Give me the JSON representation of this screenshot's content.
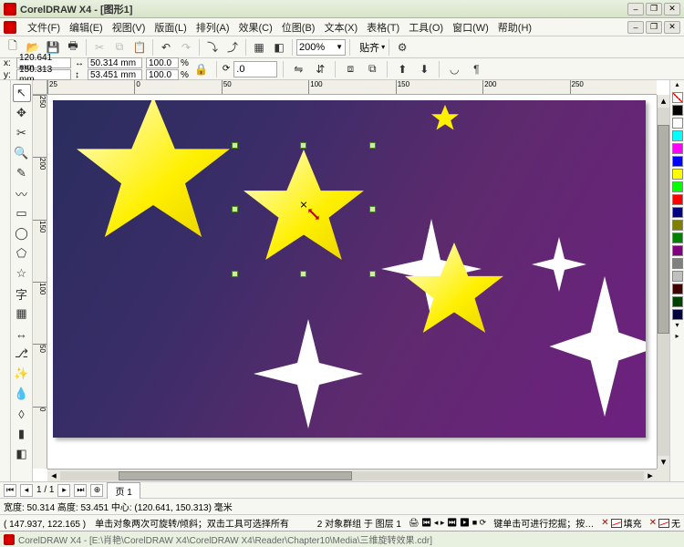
{
  "title": "CorelDRAW X4 - [图形1]",
  "menu": [
    "文件(F)",
    "编辑(E)",
    "视图(V)",
    "版面(L)",
    "排列(A)",
    "效果(C)",
    "位图(B)",
    "文本(X)",
    "表格(T)",
    "工具(O)",
    "窗口(W)",
    "帮助(H)"
  ],
  "toolbar_std": {
    "zoom": "200%",
    "snap_label": "贴齐"
  },
  "props": {
    "x": "120.641 mm",
    "y": "150.313 mm",
    "w": "50.314 mm",
    "h": "53.451 mm",
    "sx": "100.0",
    "sy": "100.0",
    "rot": ".0"
  },
  "ruler_h": [
    "25",
    "0",
    "50",
    "100",
    "150",
    "200",
    "250"
  ],
  "ruler_v": [
    "250",
    "200",
    "150",
    "100",
    "50",
    "0"
  ],
  "pager": {
    "page_of": "1 / 1",
    "tab": "页 1"
  },
  "status": {
    "dims": "宽度: 50.314 高度: 53.451 中心: (120.641, 150.313) 毫米",
    "helper_pre": "( 147.937, 122.165 )　单击对象两次可旋转/倾斜；双击工具可选择所有",
    "selection": "2 对象群组 于 图层 1",
    "helper_post": "键单击可进行挖掘；按…",
    "fill_label": "填充",
    "outline_label": "无"
  },
  "taskbar": "CorelDRAW X4 - [E:\\肖艳\\CorelDRAW X4\\CorelDRAW X4\\Reader\\Chapter10\\Media\\三维旋转效果.cdr]",
  "tools": [
    "pick",
    "shape",
    "crop",
    "zoom",
    "freehand",
    "smart",
    "rect",
    "ellipse",
    "polygon",
    "shapes",
    "text",
    "table",
    "dimension",
    "connector",
    "effects",
    "eyedrop",
    "outline",
    "fill",
    "ifill"
  ],
  "tool_glyphs": {
    "pick": "↖",
    "shape": "✥",
    "crop": "✂",
    "zoom": "🔍",
    "freehand": "✎",
    "smart": "〰",
    "rect": "▭",
    "ellipse": "◯",
    "polygon": "⬠",
    "shapes": "☆",
    "text": "字",
    "table": "▦",
    "dimension": "↔",
    "connector": "⎇",
    "effects": "✨",
    "eyedrop": "💧",
    "outline": "◊",
    "fill": "▮",
    "ifill": "◧"
  },
  "palette": [
    "#000000",
    "#ffffff",
    "#00ffff",
    "#ff00ff",
    "#0000ff",
    "#ffff00",
    "#00ff00",
    "#ff0000",
    "#000080",
    "#808000",
    "#008000",
    "#800080",
    "#808080",
    "#c0c0c0",
    "#400000",
    "#004000",
    "#000040"
  ]
}
